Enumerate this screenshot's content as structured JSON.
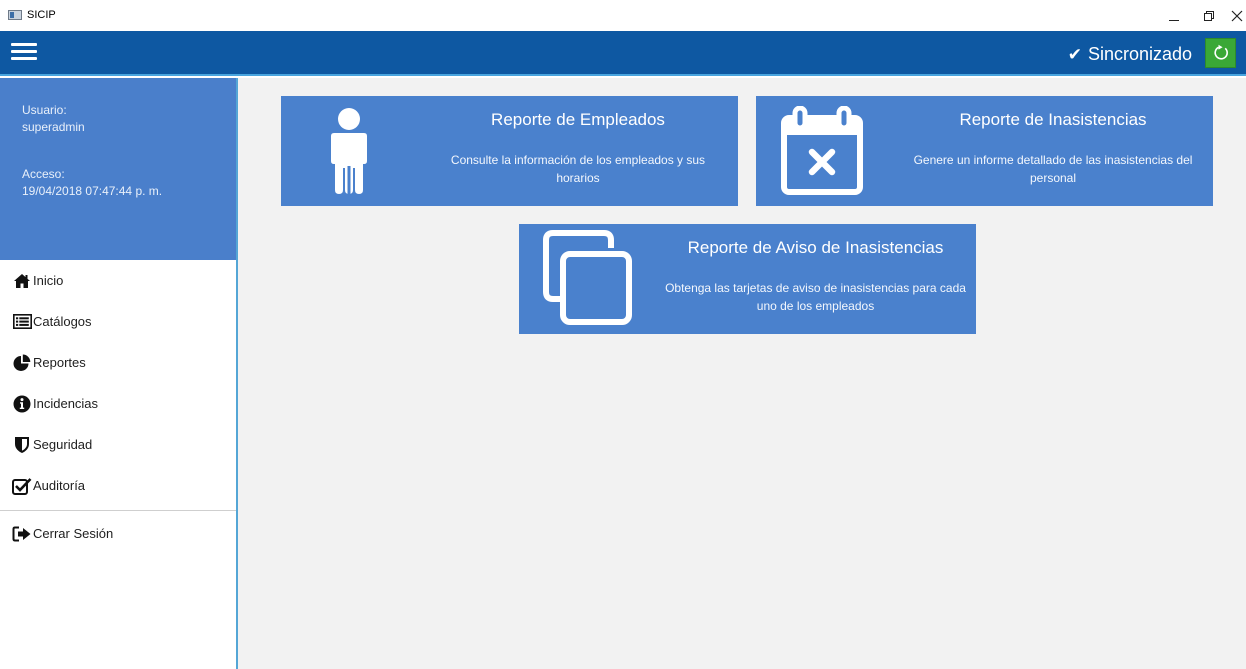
{
  "window": {
    "title": "SICIP"
  },
  "header": {
    "sync_label": "Sincronizado",
    "check_glyph": "✔"
  },
  "user": {
    "user_label": "Usuario:",
    "user_value": "superadmin",
    "access_label": "Acceso:",
    "access_value": "19/04/2018 07:47:44 p. m."
  },
  "menu": [
    {
      "label": "Inicio",
      "icon": "home-icon"
    },
    {
      "label": "Catálogos",
      "icon": "list-icon"
    },
    {
      "label": "Reportes",
      "icon": "pie-chart-icon"
    },
    {
      "label": "Incidencias",
      "icon": "info-icon"
    },
    {
      "label": "Seguridad",
      "icon": "shield-icon"
    },
    {
      "label": "Auditoría",
      "icon": "checkbox-icon"
    }
  ],
  "logout": {
    "label": "Cerrar Sesión",
    "icon": "sign-out-icon"
  },
  "cards": [
    {
      "title": "Reporte de Empleados",
      "description": "Consulte la información de los empleados y sus horarios",
      "icon": "person-icon"
    },
    {
      "title": "Reporte de Inasistencias",
      "description": "Genere un informe detallado de las inasistencias del personal",
      "icon": "calendar-x-icon"
    },
    {
      "title": "Reporte de Aviso de Inasistencias",
      "description": "Obtenga las tarjetas de aviso de inasistencias para cada uno de los empleados",
      "icon": "copy-icon"
    }
  ],
  "colors": {
    "header": "#0e58a2",
    "sidebar_user": "#4a7fcb",
    "card": "#4a81cd",
    "sync_button": "#3aa836",
    "content_bg": "#f2f2f2"
  }
}
